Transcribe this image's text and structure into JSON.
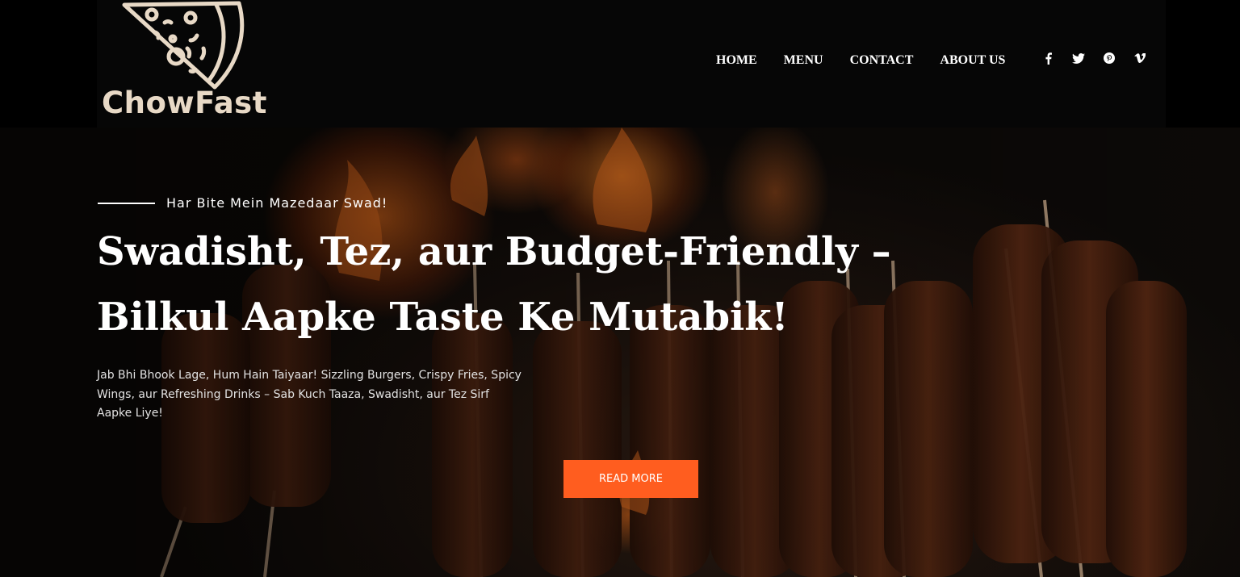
{
  "brand": {
    "name": "ChowFast",
    "logo_color": "#e8d9c6"
  },
  "nav": {
    "items": [
      {
        "label": "HOME"
      },
      {
        "label": "MENU"
      },
      {
        "label": "CONTACT"
      },
      {
        "label": "ABOUT US"
      }
    ]
  },
  "social": [
    {
      "icon": "facebook-icon"
    },
    {
      "icon": "twitter-icon"
    },
    {
      "icon": "pinterest-icon"
    },
    {
      "icon": "vimeo-icon"
    }
  ],
  "hero": {
    "eyebrow": "Har Bite Mein Mazedaar Swad!",
    "headline_line1": "Swadisht, Tez, aur Budget-Friendly –",
    "headline_line2": "Bilkul Aapke Taste Ke Mutabik!",
    "description": "Jab Bhi Bhook Lage, Hum Hain Taiyaar! Sizzling Burgers, Crispy Fries, Spicy Wings, aur Refreshing Drinks – Sab Kuch Taaza, Swadisht, aur Tez Sirf Aapke Liye!",
    "cta_label": "READ MORE",
    "cta_color": "#ff5d1f"
  }
}
